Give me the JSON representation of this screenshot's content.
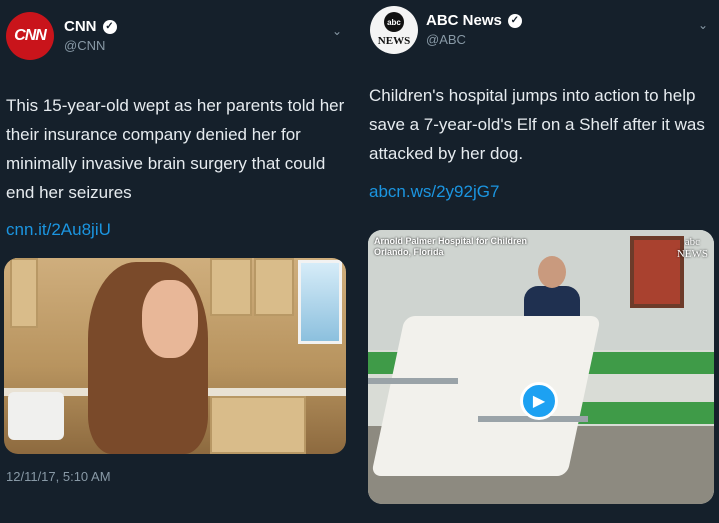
{
  "tweets": [
    {
      "name": "CNN",
      "handle": "@CNN",
      "avatar_text": "CNN",
      "verified_glyph": "✓",
      "text": "This 15-year-old wept as her parents told her their insurance company denied her for minimally invasive brain surgery that could end her seizures",
      "link": "cnn.it/2Au8jiU",
      "timestamp": "12/11/17, 5:10 AM"
    },
    {
      "name": "ABC News",
      "handle": "@ABC",
      "avatar_text": "NEWS",
      "verified_glyph": "✓",
      "text": "Children's hospital jumps into action to help save a 7-year-old's Elf on a Shelf after it was attacked by her dog.",
      "link": "abcn.ws/2y92jG7",
      "media_caption_line1": "Arnold Palmer Hospital for Children",
      "media_caption_line2": "Orlando, Florida",
      "media_logo_line1": "abc",
      "media_logo_line2": "NEWS",
      "play_icon": "play-icon"
    }
  ],
  "colors": {
    "background": "#15202b",
    "link": "#1b95e0",
    "muted": "#8899a6",
    "cnn_red": "#c9141b",
    "play": "#1da1f2"
  }
}
